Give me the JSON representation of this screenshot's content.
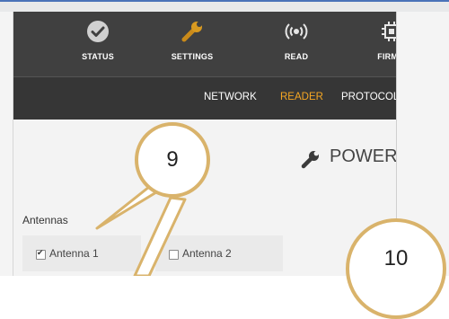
{
  "nav": {
    "items": [
      {
        "label": "STATUS",
        "icon": "check-circle-icon"
      },
      {
        "label": "SETTINGS",
        "icon": "wrench-icon"
      },
      {
        "label": "READ",
        "icon": "radio-signal-icon"
      },
      {
        "label": "FIRMW",
        "icon": "chip-icon"
      }
    ]
  },
  "subnav": {
    "items": [
      {
        "label": "NETWORK",
        "active": false
      },
      {
        "label": "READER",
        "active": true
      },
      {
        "label": "PROTOCOL",
        "active": false
      }
    ]
  },
  "content": {
    "section_title": "POWER",
    "antennas_label": "Antennas",
    "antennas": [
      {
        "label": "Antenna 1",
        "checked": true
      },
      {
        "label": "Antenna 2",
        "checked": false
      }
    ]
  },
  "annotations": {
    "callout_9": "9",
    "callout_10": "10"
  },
  "colors": {
    "nav_bg": "#404040",
    "subnav_bg": "#363636",
    "active_accent": "#f5a623",
    "callout_border": "#d9b36b"
  }
}
